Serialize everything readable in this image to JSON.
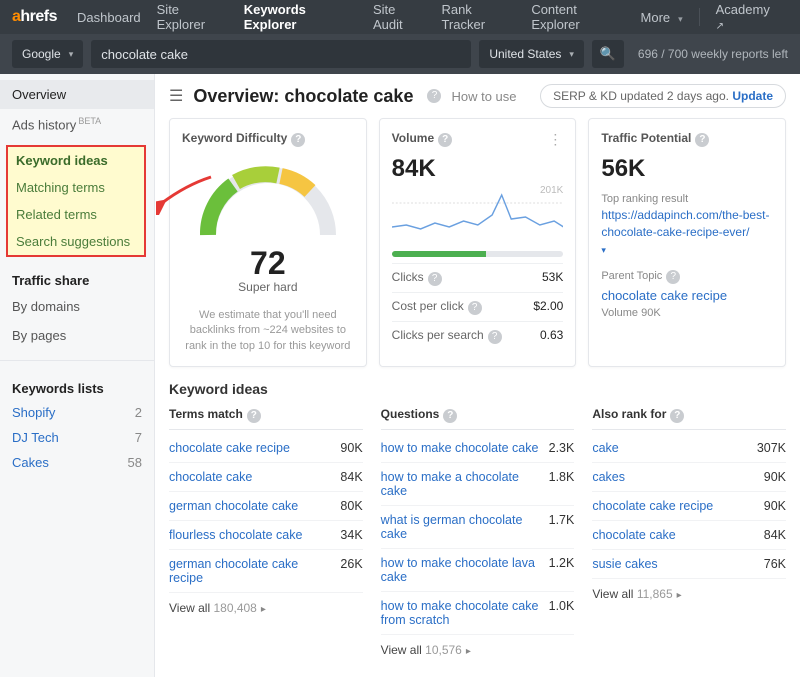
{
  "nav": {
    "logo_a": "a",
    "logo_rest": "hrefs",
    "items": [
      "Dashboard",
      "Site Explorer",
      "Keywords Explorer",
      "Site Audit",
      "Rank Tracker",
      "Content Explorer"
    ],
    "more": "More",
    "academy": "Academy"
  },
  "search": {
    "engine": "Google",
    "query": "chocolate cake",
    "country": "United States",
    "reports": "696 / 700 weekly reports left"
  },
  "sidebar": {
    "overview": "Overview",
    "ads_history": "Ads history",
    "beta": "BETA",
    "hl": {
      "head": "Keyword ideas",
      "items": [
        "Matching terms",
        "Related terms",
        "Search suggestions"
      ]
    },
    "traffic_share": "Traffic share",
    "by_domains": "By domains",
    "by_pages": "By pages",
    "lists_head": "Keywords lists",
    "lists": [
      {
        "name": "Shopify",
        "count": "2"
      },
      {
        "name": "DJ Tech",
        "count": "7"
      },
      {
        "name": "Cakes",
        "count": "58"
      }
    ]
  },
  "header": {
    "title_prefix": "Overview: ",
    "title_kw": "chocolate cake",
    "howto": "How to use",
    "serp": "SERP & KD updated 2 days ago.",
    "update": "Update"
  },
  "kd": {
    "title": "Keyword Difficulty",
    "value": "72",
    "label": "Super hard",
    "desc": "We estimate that you'll need backlinks from ~224 websites to rank in the top 10 for this keyword"
  },
  "volume": {
    "title": "Volume",
    "value": "84K",
    "peak": "201K",
    "metrics": [
      {
        "k": "Clicks",
        "v": "53K"
      },
      {
        "k": "Cost per click",
        "v": "$2.00"
      },
      {
        "k": "Clicks per search",
        "v": "0.63"
      }
    ]
  },
  "tp": {
    "title": "Traffic Potential",
    "value": "56K",
    "top_label": "Top ranking result",
    "top_url": "https://addapinch.com/the-best-chocolate-cake-recipe-ever/",
    "parent_label": "Parent Topic",
    "parent_kw": "chocolate cake recipe",
    "parent_vol": "Volume 90K"
  },
  "ki": {
    "head": "Keyword ideas",
    "cols": [
      {
        "title": "Terms match",
        "rows": [
          {
            "kw": "chocolate cake recipe",
            "v": "90K"
          },
          {
            "kw": "chocolate cake",
            "v": "84K"
          },
          {
            "kw": "german chocolate cake",
            "v": "80K"
          },
          {
            "kw": "flourless chocolate cake",
            "v": "34K"
          },
          {
            "kw": "german chocolate cake recipe",
            "v": "26K"
          }
        ],
        "viewall": "View all",
        "total": "180,408"
      },
      {
        "title": "Questions",
        "rows": [
          {
            "kw": "how to make chocolate cake",
            "v": "2.3K"
          },
          {
            "kw": "how to make a chocolate cake",
            "v": "1.8K"
          },
          {
            "kw": "what is german chocolate cake",
            "v": "1.7K"
          },
          {
            "kw": "how to make chocolate lava cake",
            "v": "1.2K"
          },
          {
            "kw": "how to make chocolate cake from scratch",
            "v": "1.0K"
          }
        ],
        "viewall": "View all",
        "total": "10,576"
      },
      {
        "title": "Also rank for",
        "rows": [
          {
            "kw": "cake",
            "v": "307K"
          },
          {
            "kw": "cakes",
            "v": "90K"
          },
          {
            "kw": "chocolate cake recipe",
            "v": "90K"
          },
          {
            "kw": "chocolate cake",
            "v": "84K"
          },
          {
            "kw": "susie cakes",
            "v": "76K"
          }
        ],
        "viewall": "View all",
        "total": "11,865"
      }
    ]
  }
}
